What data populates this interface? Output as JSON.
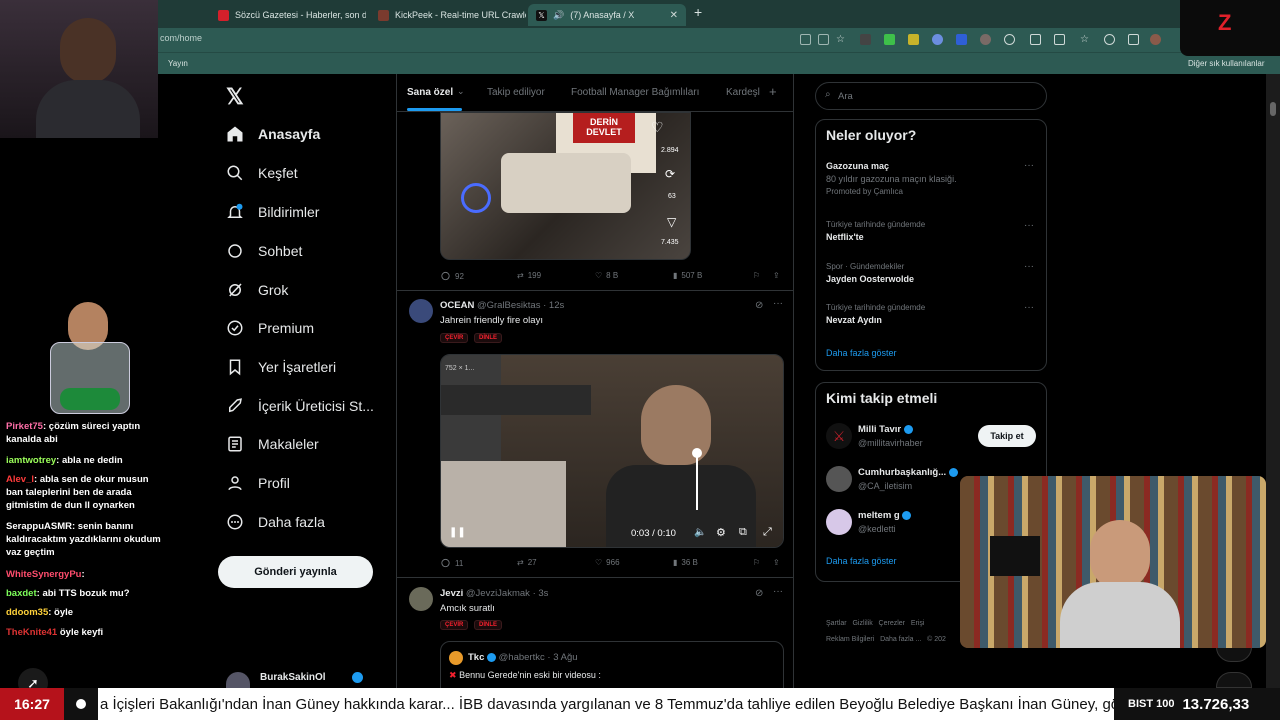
{
  "browser": {
    "tabs": [
      {
        "label": "Sözcü Gazetesi - Haberler, son da",
        "color": "#d4202b"
      },
      {
        "label": "KickPeek - Real-time URL Crawler",
        "color": "#7a3b2e"
      },
      {
        "label": "(7) Anasayfa / X",
        "color": "#111111"
      }
    ],
    "new_tab": "+",
    "url": "com/home",
    "bookmarks": {
      "left": "Yayın",
      "right": "Diğer sık kullanılanlar"
    }
  },
  "nav": {
    "items": [
      {
        "label": "Anasayfa",
        "icon": "home-icon"
      },
      {
        "label": "Keşfet",
        "icon": "search-icon"
      },
      {
        "label": "Bildirimler",
        "icon": "bell-icon",
        "badge": "7"
      },
      {
        "label": "Sohbet",
        "icon": "chat-icon"
      },
      {
        "label": "Grok",
        "icon": "grok-icon"
      },
      {
        "label": "Premium",
        "icon": "premium-icon"
      },
      {
        "label": "Yer İşaretleri",
        "icon": "bookmark-icon"
      },
      {
        "label": "İçerik Üreticisi St...",
        "icon": "rocket-icon"
      },
      {
        "label": "Makaleler",
        "icon": "article-icon"
      },
      {
        "label": "Profil",
        "icon": "person-icon"
      },
      {
        "label": "Daha fazla",
        "icon": "more-icon"
      }
    ],
    "post_button": "Gönderi yayınla",
    "account": "BurakSakinOl"
  },
  "timeline": {
    "tabs": [
      "Sana özel",
      "Takip ediliyor",
      "Football Manager Bağımlıları",
      "Kardeşl"
    ],
    "post0": {
      "image_text": [
        "DERİN",
        "DEVLET"
      ],
      "side_stats": [
        "2.894",
        "63",
        "7.435"
      ],
      "actions": {
        "reply": "92",
        "repost": "199",
        "like": "8 B",
        "views": "507 B"
      }
    },
    "post1": {
      "name": "OCEAN",
      "handle": "@GralBesiktas",
      "time": "12s",
      "text": "Jahrein friendly fire olayı",
      "pills": [
        "ÇEVİR",
        "DİNLE"
      ],
      "video": {
        "timecode": "0:03 / 0:10",
        "overlay": "752 × 1..."
      },
      "actions": {
        "reply": "11",
        "repost": "27",
        "like": "966",
        "views": "36 B"
      }
    },
    "post2": {
      "name": "Jevzi",
      "handle": "@JevziJakmak",
      "time": "3s",
      "text": "Amcık suratlı",
      "pills": [
        "ÇEVİR",
        "DİNLE"
      ],
      "quote": {
        "name": "Tkc",
        "handle": "@habertkc",
        "time": "3 Ağu",
        "text": "Bennu Gerede'nin eski bir videosu :"
      }
    }
  },
  "right": {
    "search_placeholder": "Ara",
    "trends_title": "Neler oluyor?",
    "trends": [
      {
        "context": "",
        "name": "Gazozuna maç",
        "sub": "80 yıldır gazozuna maçın klasiği.",
        "promo": "Promoted by Çamlıca"
      },
      {
        "context": "Türkiye tarihinde gündemde",
        "name": "Netflix'te"
      },
      {
        "context": "Spor · Gündemdekiler",
        "name": "Jayden Oosterwolde"
      },
      {
        "context": "Türkiye tarihinde gündemde",
        "name": "Nevzat Aydın"
      }
    ],
    "trends_more": "Daha fazla göster",
    "follow_title": "Kimi takip etmeli",
    "follow": [
      {
        "name": "Milli Tavır",
        "handle": "@millitavirhaber",
        "button": "Takip et"
      },
      {
        "name": "Cumhurbaşkanlığ...",
        "handle": "@CA_iletisim"
      },
      {
        "name": "meltem g",
        "handle": "@kedletti"
      }
    ],
    "follow_more": "Daha fazla göster",
    "footer": [
      "Şartlar",
      "Gizlilik",
      "Çerezler",
      "Erişi",
      "Reklam Bilgileri",
      "Daha fazla ...",
      "© 202"
    ]
  },
  "chat": [
    {
      "user": "Pirket75",
      "msg": "çözüm süreci yaptın kanalda abi",
      "color": "#ff6fa8"
    },
    {
      "user": "iamtwotrey",
      "msg": "abla ne dedin",
      "color": "#9cff5a"
    },
    {
      "user": "Alev_l",
      "msg": "abla sen de okur musun ban taleplerini ben de arada gitmistim de dun ll oynarken",
      "color": "#ff3b3b"
    },
    {
      "user": "SerappuASMR",
      "msg": "senin banını kaldıracaktım yazdıklarını okudum vaz geçtim",
      "color": "#ffffff"
    },
    {
      "user": "WhiteSynergyPu",
      "msg": "",
      "color": "#ff4d6d"
    },
    {
      "user": "baxdet",
      "msg": "abi TTS bozuk mu?",
      "color": "#7dff5a"
    },
    {
      "user": "ddoom35",
      "msg": "öyle",
      "color": "#ffd23a"
    },
    {
      "user": "TheKnite41",
      "msg": "öyle keyfi",
      "color": "#d33"
    }
  ],
  "ticker": {
    "time": "16:27",
    "news": "a İçişleri Bakanlığı'ndan İnan Güney hakkında karar... İBB davasında yargılanan ve 8 Temmuz'da tahliye edilen Beyoğlu Belediye Başkanı İnan Güney, göreve",
    "index_label": "BIST 100",
    "index_value": "13.726,33"
  },
  "colors": {
    "accent": "#1d9bf0",
    "chrome": "#2d5a53",
    "ticker_red": "#b5121b"
  }
}
